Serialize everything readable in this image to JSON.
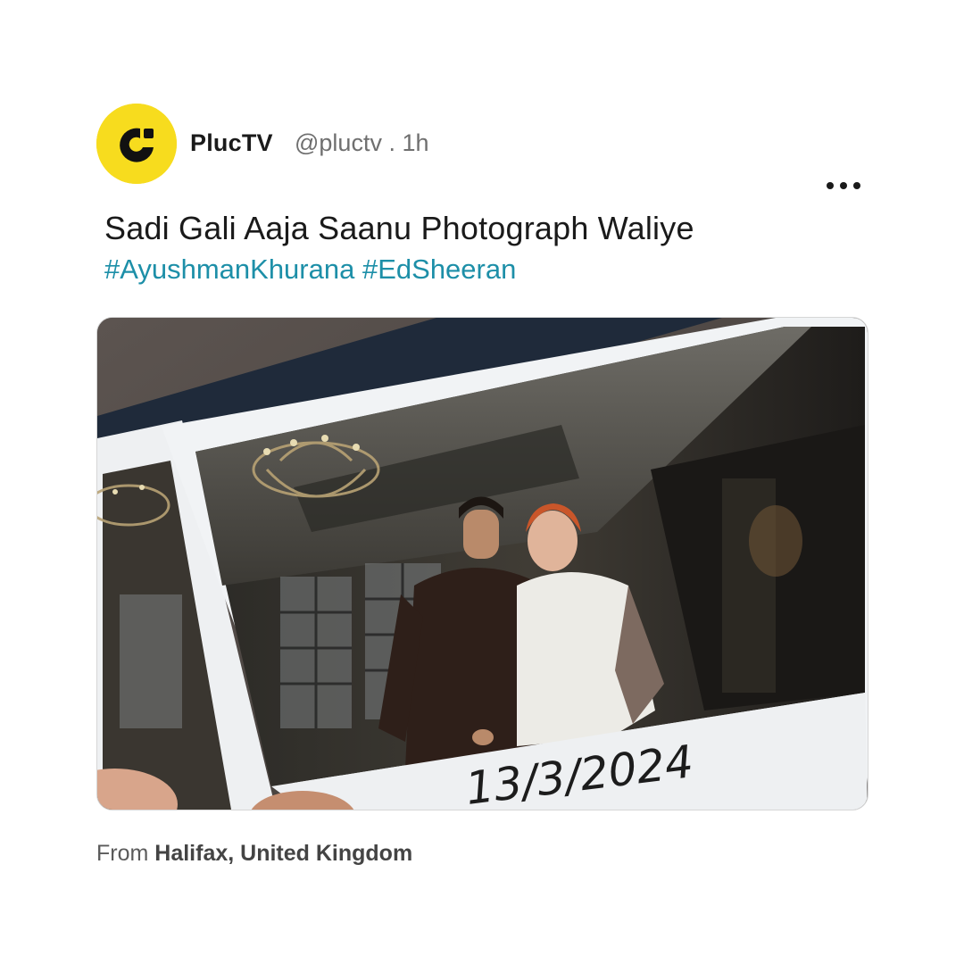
{
  "post": {
    "author": {
      "display_name": "PlucTV",
      "handle_time": "@pluctv . 1h",
      "avatar_icon": "pluctv-logo-icon",
      "avatar_color": "#f7dc1e"
    },
    "text": "Sadi Gali Aaja Saanu Photograph Waliye",
    "hashtags": [
      "#AyushmanKhurana",
      "#EdSheeran"
    ],
    "hashtag_color": "#1d8fa8",
    "more_icon": "more-horizontal-icon",
    "media": {
      "kind": "photo of instant polaroid prints",
      "caption_on_photo": "13/3/2024"
    },
    "location": {
      "prefix": "From",
      "place": "Halifax, United Kingdom"
    }
  }
}
